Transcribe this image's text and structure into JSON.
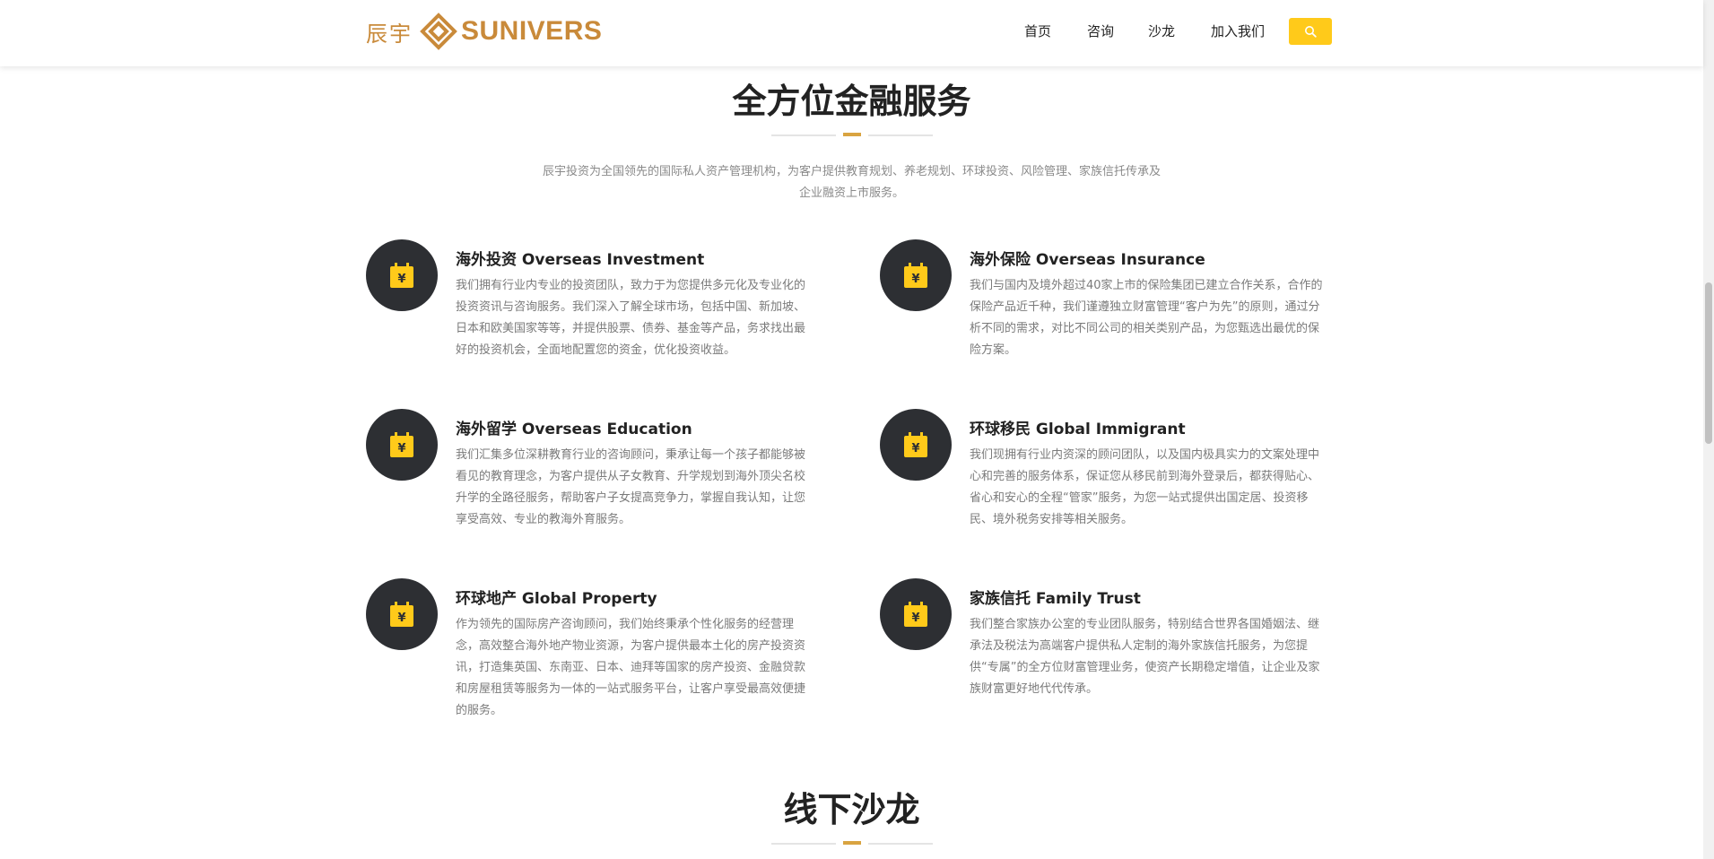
{
  "header": {
    "logo_cn": "辰宇",
    "logo_en": "SUNIVERS",
    "nav": [
      "首页",
      "咨询",
      "沙龙",
      "加入我们"
    ],
    "search_icon": "search-icon",
    "accent_color": "#ffca1a",
    "brand_color": "#c98a3a"
  },
  "services_section": {
    "title": "全方位金融服务",
    "intro": "辰宇投资为全国领先的国际私人资产管理机构，为客户提供教育规划、养老规划、环球投资、风险管理、家族信托传承及企业融资上市服务。",
    "items": [
      {
        "title": "海外投资 Overseas Investment",
        "desc": "我们拥有行业内专业的投资团队，致力于为您提供多元化及专业化的投资资讯与咨询服务。我们深入了解全球市场，包括中国、新加坡、日本和欧美国家等等，并提供股票、债券、基金等产品，务求找出最好的投资机会，全面地配置您的资金，优化投资收益。"
      },
      {
        "title": "海外保险 Overseas Insurance",
        "desc": "我们与国内及境外超过40家上市的保险集团已建立合作关系，合作的保险产品近千种，我们谨遵独立财富管理“客户为先”的原则，通过分析不同的需求，对比不同公司的相关类别产品，为您甄选出最优的保险方案。"
      },
      {
        "title": "海外留学 Overseas Education",
        "desc": "我们汇集多位深耕教育行业的咨询顾问，秉承让每一个孩子都能够被看见的教育理念，为客户提供从子女教育、升学规划到海外顶尖名校升学的全路径服务，帮助客户子女提高竞争力，掌握自我认知，让您享受高效、专业的教海外育服务。"
      },
      {
        "title": "环球移民 Global Immigrant",
        "desc": "我们现拥有行业内资深的顾问团队，以及国内极具实力的文案处理中心和完善的服务体系，保证您从移民前到海外登录后，都获得贴心、省心和安心的全程“管家”服务，为您一站式提供出国定居、投资移民、境外税务安排等相关服务。"
      },
      {
        "title": "环球地产 Global Property",
        "desc": "作为领先的国际房产咨询顾问，我们始终秉承个性化服务的经营理念，高效整合海外地产物业资源，为客户提供最本土化的房产投资资讯，打造集英国、东南亚、日本、迪拜等国家的房产投资、金融贷款和房屋租赁等服务为一体的一站式服务平台，让客户享受最高效便捷的服务。"
      },
      {
        "title": "家族信托 Family Trust",
        "desc": "我们整合家族办公室的专业团队服务，特别结合世界各国婚姻法、继承法及税法为高端客户提供私人定制的海外家族信托服务，为您提供“专属”的全方位财富管理业务，使资产长期稳定增值，让企业及家族财富更好地代代传承。"
      }
    ]
  },
  "salon_section": {
    "title": "线下沙龙"
  }
}
